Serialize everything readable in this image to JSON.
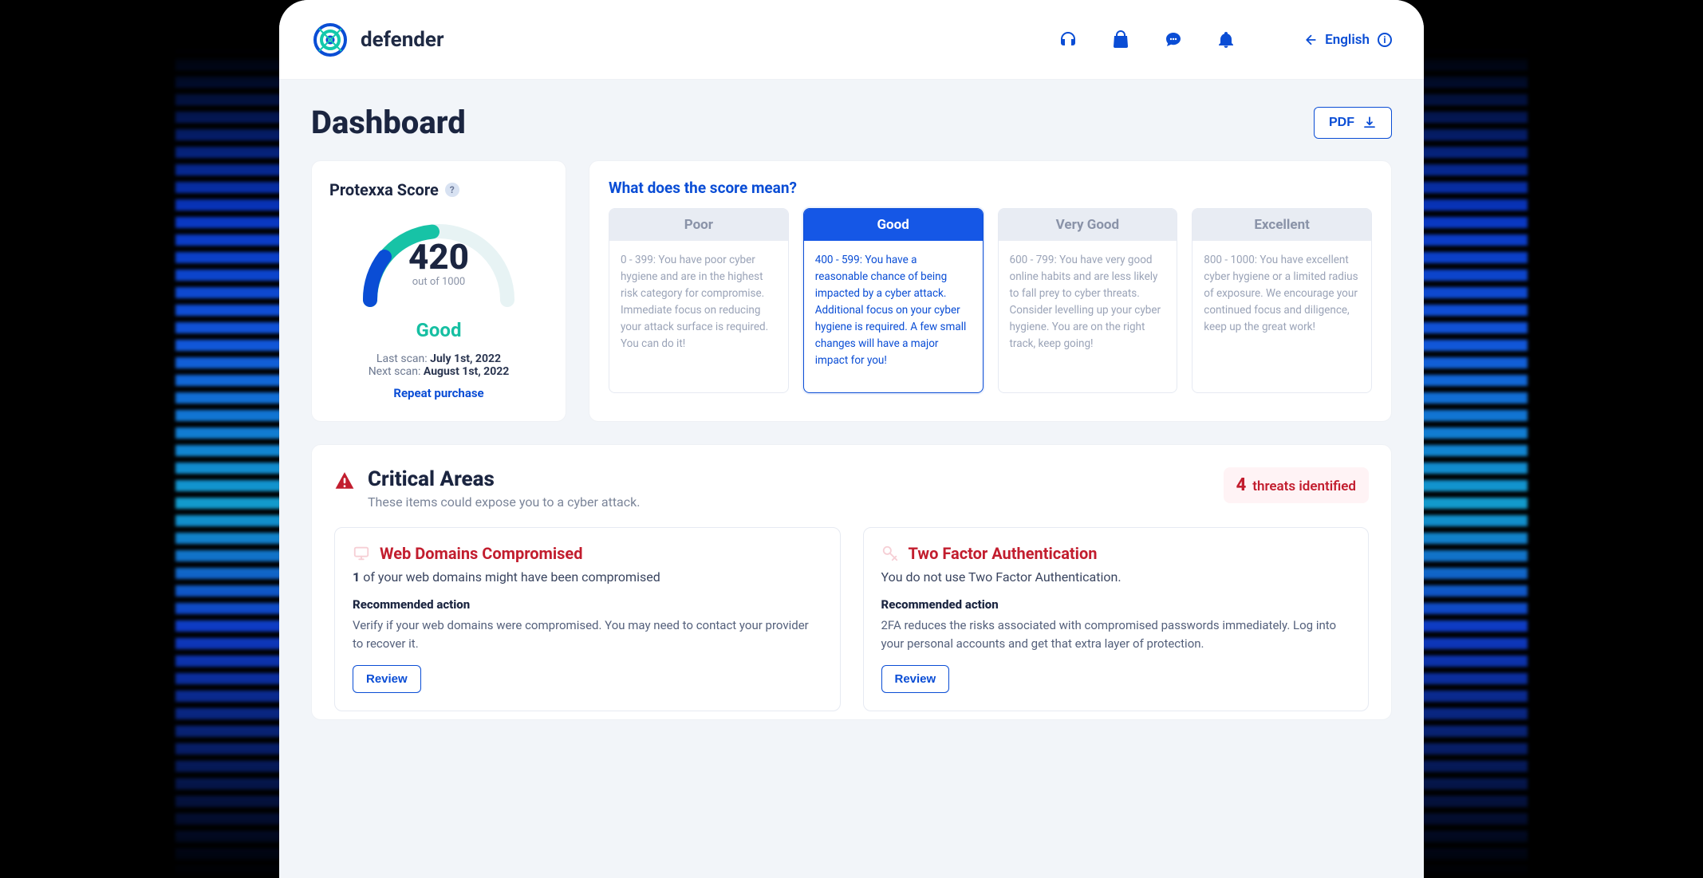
{
  "brand": "defender",
  "header": {
    "language_label": "English"
  },
  "page": {
    "title": "Dashboard",
    "pdf_label": "PDF"
  },
  "score": {
    "title": "Protexxa Score",
    "value": "420",
    "out_of_label": "out of 1000",
    "rating": "Good",
    "last_scan_label": "Last scan:",
    "last_scan_value": "July 1st, 2022",
    "next_scan_label": "Next scan:",
    "next_scan_value": "August 1st, 2022",
    "repeat_label": "Repeat purchase"
  },
  "meaning": {
    "title": "What does the score mean?",
    "active_index": 1,
    "tiers": [
      {
        "name": "Poor",
        "body": "0 - 399: You have poor cyber hygiene and are in the highest risk category for compromise. Immediate focus on reducing your attack surface is required. You can do it!"
      },
      {
        "name": "Good",
        "body": "400 - 599: You have a reasonable chance of being impacted by a cyber attack. Additional focus on your cyber hygiene is required. A few small changes will have a major  impact for you!"
      },
      {
        "name": "Very Good",
        "body": "600 - 799: You have very good online habits and are less likely to fall prey to cyber threats. Consider levelling up your cyber hygiene. You are on the right track, keep going!"
      },
      {
        "name": "Excellent",
        "body": "800 - 1000: You have excellent cyber hygiene or a limited radius of exposure. We encourage your continued focus and diligence, keep up the great work!"
      }
    ]
  },
  "critical": {
    "heading": "Critical Areas",
    "subheading": "These items could expose you to a cyber attack.",
    "threat_count": "4",
    "threat_count_label": "threats identified",
    "items": [
      {
        "title": "Web Domains Compromised",
        "summary_prefix": "1",
        "summary_rest": " of your web domains might have been compromised",
        "rec_label": "Recommended action",
        "rec_body": "Verify if your web domains were compromised. You may need to contact your provider to recover it.",
        "button": "Review"
      },
      {
        "title": "Two Factor Authentication",
        "summary_prefix": "",
        "summary_rest": "You do not use Two Factor Authentication.",
        "rec_label": "Recommended action",
        "rec_body": "2FA reduces the risks associated with compromised passwords immediately. Log into your personal accounts and get that extra layer of protection.",
        "button": "Review"
      }
    ]
  },
  "colors": {
    "primary": "#0a4dd5",
    "danger": "#c21d2e",
    "teal": "#16bfa2"
  }
}
